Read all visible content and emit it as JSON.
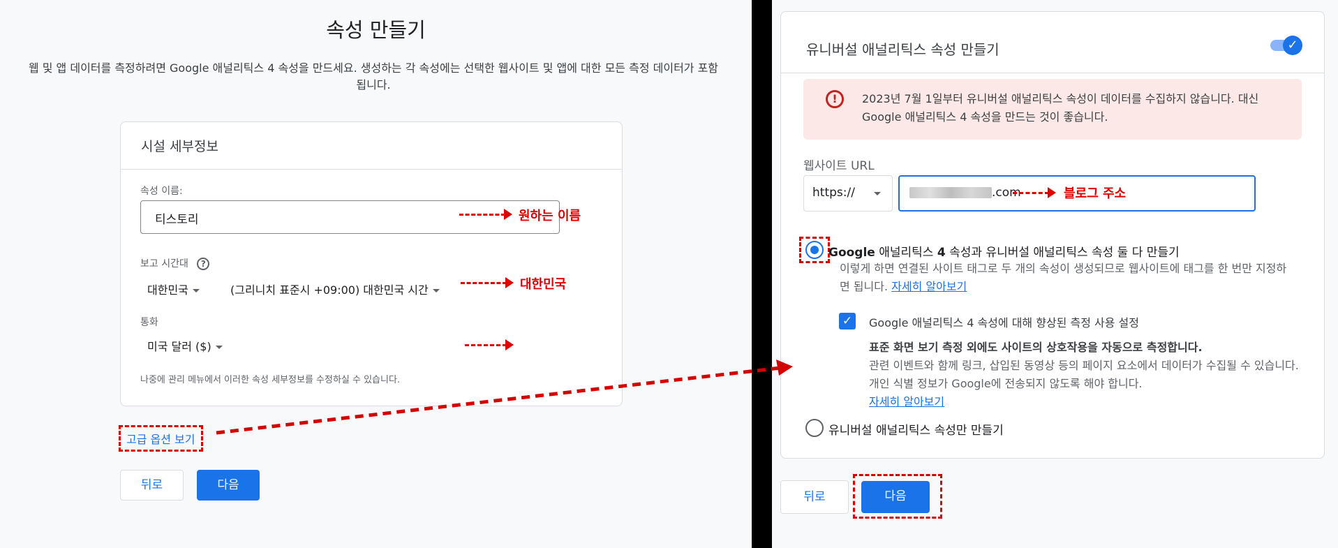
{
  "left": {
    "title": "속성 만들기",
    "description": "웹 및 앱 데이터를 측정하려면 Google 애널리틱스 4 속성을 만드세요. 생성하는 각 속성에는 선택한 웹사이트 및 앱에 대한 모든 측정 데이터가 포함됩니다.",
    "card_title": "시설 세부정보",
    "property_name_label": "속성 이름:",
    "property_name_value": "티스토리",
    "timezone_label": "보고 시간대",
    "help_glyph": "?",
    "country": "대한민국",
    "timezone": "(그리니치 표준시 +09:00) 대한민국 시간",
    "currency_label": "통화",
    "currency": "미국 달러 ($)",
    "note": "나중에 관리 메뉴에서 이러한 속성 세부정보를 수정하실 수 있습니다.",
    "advanced_link": "고급 옵션 보기",
    "back_button": "뒤로",
    "next_button": "다음",
    "annotations": {
      "name": "원하는 이름",
      "country": "대한민국"
    }
  },
  "right": {
    "ua_title": "유니버설 애널리틱스 속성 만들기",
    "toggle_on": true,
    "toggle_glyph": "✓",
    "alert_glyph": "!",
    "alert_text": "2023년 7월 1일부터 유니버설 애널리틱스 속성이 데이터를 수집하지 않습니다. 대신 Google 애널리틱스 4 속성을 만드는 것이 좋습니다.",
    "url_label": "웹사이트 URL",
    "protocol": "https://",
    "url_suffix": ".com",
    "annotation_url": "블로그 주소",
    "option1_title_bold": "Google",
    "option1_title_rest": " 애널리틱스 ",
    "option1_title_bold2": "4",
    "option1_title_end": " 속성과 유니버설 애널리틱스 속성 둘 다 만들기",
    "option1_desc": "이렇게 하면 연결된 사이트 태그로 두 개의 속성이 생성되므로 웹사이트에 태그를 한 번만 지정하면 됩니다. ",
    "option1_link": "자세히 알아보기",
    "enhanced_label": "Google 애널리틱스 4 속성에 대해 향상된 측정 사용 설정",
    "checkbox_glyph": "✓",
    "enhanced_bold": "표준 화면 보기 측정 외에도 사이트의 상호작용을 자동으로 측정합니다.",
    "enhanced_desc": "관련 이벤트와 함께 링크, 삽입된 동영상 등의 페이지 요소에서 데이터가 수집될 수 있습니다. 개인 식별 정보가 Google에 전송되지 않도록 해야 합니다.",
    "enhanced_link": "자세히 알아보기",
    "option2_title": "유니버설 애널리틱스 속성만 만들기",
    "back_button": "뒤로",
    "next_button": "다음"
  },
  "colors": {
    "accent": "#1a73e8",
    "annotation": "#e00000",
    "alert_bg": "#fce8e6"
  }
}
